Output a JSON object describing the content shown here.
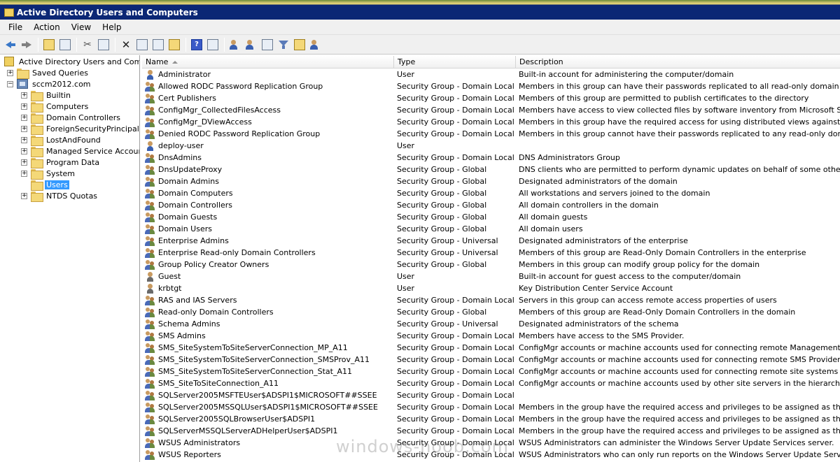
{
  "window": {
    "title": "Active Directory Users and Computers"
  },
  "menu": [
    "File",
    "Action",
    "View",
    "Help"
  ],
  "tree": {
    "root": "Active Directory Users and Computers",
    "saved_queries": "Saved Queries",
    "domain": "sccm2012.com",
    "children": [
      "Builtin",
      "Computers",
      "Domain Controllers",
      "ForeignSecurityPrincipals",
      "LostAndFound",
      "Managed Service Accounts",
      "Program Data",
      "System",
      "Users",
      "NTDS Quotas"
    ],
    "selected": "Users"
  },
  "columns": {
    "name": "Name",
    "type": "Type",
    "description": "Description"
  },
  "rows": [
    {
      "name": "Administrator",
      "type": "User",
      "description": "Built-in account for administering the computer/domain",
      "icon": "user"
    },
    {
      "name": "Allowed RODC Password Replication Group",
      "type": "Security Group - Domain Local",
      "description": "Members in this group can have their passwords replicated to all read-only domain controllers in",
      "icon": "group"
    },
    {
      "name": "Cert Publishers",
      "type": "Security Group - Domain Local",
      "description": "Members of this group are permitted to publish certificates to the directory",
      "icon": "group"
    },
    {
      "name": "ConfigMgr_CollectedFilesAccess",
      "type": "Security Group - Domain Local",
      "description": "Members have access to view collected files by software inventory from Microsoft System Cente",
      "icon": "group"
    },
    {
      "name": "ConfigMgr_DViewAccess",
      "type": "Security Group - Domain Local",
      "description": "Members in this group have the required access for using distributed views against the ConfigM",
      "icon": "group"
    },
    {
      "name": "Denied RODC Password Replication Group",
      "type": "Security Group - Domain Local",
      "description": "Members in this group cannot have their passwords replicated to any read-only domain controlle",
      "icon": "group"
    },
    {
      "name": "deploy-user",
      "type": "User",
      "description": "",
      "icon": "user"
    },
    {
      "name": "DnsAdmins",
      "type": "Security Group - Domain Local",
      "description": "DNS Administrators Group",
      "icon": "group"
    },
    {
      "name": "DnsUpdateProxy",
      "type": "Security Group - Global",
      "description": "DNS clients who are permitted to perform dynamic updates on behalf of some other clients (such",
      "icon": "group"
    },
    {
      "name": "Domain Admins",
      "type": "Security Group - Global",
      "description": "Designated administrators of the domain",
      "icon": "group"
    },
    {
      "name": "Domain Computers",
      "type": "Security Group - Global",
      "description": "All workstations and servers joined to the domain",
      "icon": "group"
    },
    {
      "name": "Domain Controllers",
      "type": "Security Group - Global",
      "description": "All domain controllers in the domain",
      "icon": "group"
    },
    {
      "name": "Domain Guests",
      "type": "Security Group - Global",
      "description": "All domain guests",
      "icon": "group"
    },
    {
      "name": "Domain Users",
      "type": "Security Group - Global",
      "description": "All domain users",
      "icon": "group"
    },
    {
      "name": "Enterprise Admins",
      "type": "Security Group - Universal",
      "description": "Designated administrators of the enterprise",
      "icon": "group"
    },
    {
      "name": "Enterprise Read-only Domain Controllers",
      "type": "Security Group - Universal",
      "description": "Members of this group are Read-Only Domain Controllers in the enterprise",
      "icon": "group"
    },
    {
      "name": "Group Policy Creator Owners",
      "type": "Security Group - Global",
      "description": "Members in this group can modify group policy for the domain",
      "icon": "group"
    },
    {
      "name": "Guest",
      "type": "User",
      "description": "Built-in account for guest access to the computer/domain",
      "icon": "user-disabled"
    },
    {
      "name": "krbtgt",
      "type": "User",
      "description": "Key Distribution Center Service Account",
      "icon": "user-disabled"
    },
    {
      "name": "RAS and IAS Servers",
      "type": "Security Group - Domain Local",
      "description": "Servers in this group can access remote access properties of users",
      "icon": "group"
    },
    {
      "name": "Read-only Domain Controllers",
      "type": "Security Group - Global",
      "description": "Members of this group are Read-Only Domain Controllers in the domain",
      "icon": "group"
    },
    {
      "name": "Schema Admins",
      "type": "Security Group - Universal",
      "description": "Designated administrators of the schema",
      "icon": "group"
    },
    {
      "name": "SMS Admins",
      "type": "Security Group - Domain Local",
      "description": "Members have access to the SMS Provider.",
      "icon": "group"
    },
    {
      "name": "SMS_SiteSystemToSiteServerConnection_MP_A11",
      "type": "Security Group - Domain Local",
      "description": "ConfigMgr accounts or machine accounts used for connecting remote Management Point to the s",
      "icon": "group"
    },
    {
      "name": "SMS_SiteSystemToSiteServerConnection_SMSProv_A11",
      "type": "Security Group - Domain Local",
      "description": "ConfigMgr accounts or machine accounts used for connecting remote SMS Providers to the site s",
      "icon": "group"
    },
    {
      "name": "SMS_SiteSystemToSiteServerConnection_Stat_A11",
      "type": "Security Group - Domain Local",
      "description": "ConfigMgr accounts or machine accounts used for connecting remote site systems to the site se",
      "icon": "group"
    },
    {
      "name": "SMS_SiteToSiteConnection_A11",
      "type": "Security Group - Domain Local",
      "description": "ConfigMgr accounts or machine accounts used by other site servers in the hierarchy to connect",
      "icon": "group"
    },
    {
      "name": "SQLServer2005MSFTEUser$ADSPI1$MICROSOFT##SSEE",
      "type": "Security Group - Domain Local",
      "description": "",
      "icon": "group"
    },
    {
      "name": "SQLServer2005MSSQLUser$ADSPI1$MICROSOFT##SSEE",
      "type": "Security Group - Domain Local",
      "description": "Members in the group have the required access and privileges to be assigned as the log on acco",
      "icon": "group"
    },
    {
      "name": "SQLServer2005SQLBrowserUser$ADSPI1",
      "type": "Security Group - Domain Local",
      "description": "Members in the group have the required access and privileges to be assigned as the log on acco",
      "icon": "group"
    },
    {
      "name": "SQLServerMSSQLServerADHelperUser$ADSPI1",
      "type": "Security Group - Domain Local",
      "description": "Members in the group have the required access and privileges to be assigned as the log on acco",
      "icon": "group"
    },
    {
      "name": "WSUS Administrators",
      "type": "Security Group - Domain Local",
      "description": "WSUS Administrators can administer the Windows Server Update Services server.",
      "icon": "group"
    },
    {
      "name": "WSUS Reporters",
      "type": "Security Group - Domain Local",
      "description": "WSUS Administrators who can only run reports on the Windows Server Update Services server.",
      "icon": "group"
    }
  ],
  "watermark": "windows-noob.com"
}
